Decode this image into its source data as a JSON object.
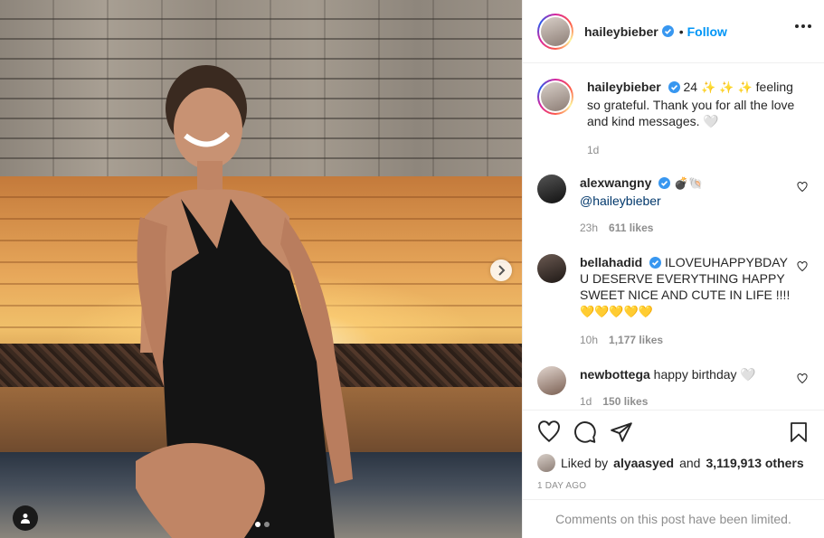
{
  "post": {
    "author": "haileybieber",
    "follow_label": "Follow",
    "bullet": "•",
    "caption_prefix": "24",
    "caption_emoji": "✨ ✨ ✨",
    "caption_text": " feeling so grateful. Thank you for all the love and kind messages. 🤍",
    "caption_time": "1d",
    "carousel_dots": 2,
    "active_dot": 1
  },
  "comments": [
    {
      "user": "alexwangny",
      "verified": true,
      "text_emoji": "💣🐚",
      "text": "",
      "mention": "@haileybieber",
      "time": "23h",
      "likes": "611 likes"
    },
    {
      "user": "bellahadid",
      "verified": true,
      "text": "ILOVEUHAPPYBDAY U DESERVE EVERYTHING HAPPY SWEET NICE AND CUTE IN LIFE !!!!",
      "text_emoji2": "💛💛💛💛💛",
      "time": "10h",
      "likes": "1,177 likes"
    },
    {
      "user": "newbottega",
      "verified": false,
      "text": "happy birthday 🤍",
      "time": "1d",
      "likes": "150 likes"
    }
  ],
  "actions": {
    "liked_by_prefix": "Liked by",
    "liked_by_user": "alyaasyed",
    "liked_by_and": "and",
    "liked_by_count": "3,119,913 others",
    "date": "1 DAY AGO",
    "limited": "Comments on this post have been limited."
  },
  "colors": {
    "link": "#0095f6",
    "text": "#262626",
    "muted": "#8e8e8e",
    "verified": "#3897f0"
  },
  "icons": [
    "user-tag-icon",
    "chevron-right-icon",
    "more-icon",
    "verified-icon",
    "heart-icon",
    "comment-icon",
    "share-icon",
    "bookmark-icon"
  ]
}
